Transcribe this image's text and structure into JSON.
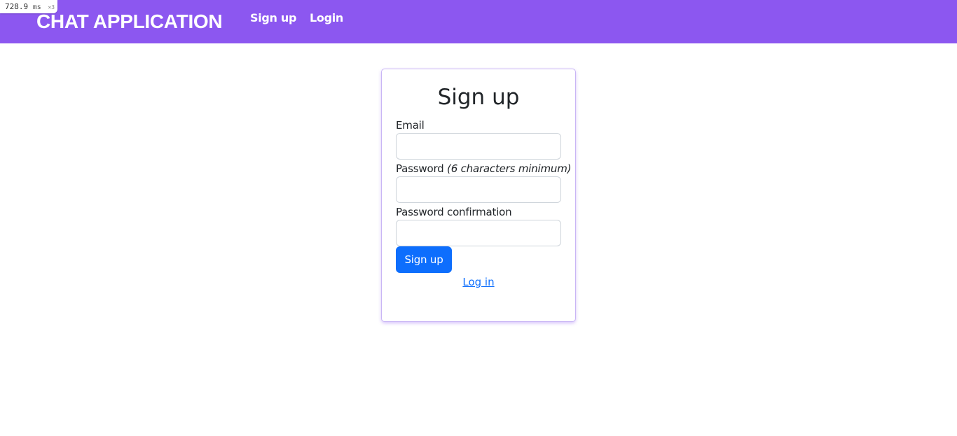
{
  "debug": {
    "time_value": "728.9",
    "time_unit": "ms",
    "multiplier": "×3"
  },
  "navbar": {
    "brand": "CHAT APPLICATION",
    "links": [
      {
        "label": "Sign up"
      },
      {
        "label": "Login"
      }
    ],
    "background": "#8c57f0"
  },
  "form": {
    "title": "Sign up",
    "email": {
      "label": "Email",
      "value": "",
      "placeholder": ""
    },
    "password": {
      "label": "Password",
      "hint": "(6 characters minimum)",
      "value": "",
      "placeholder": ""
    },
    "password_confirmation": {
      "label": "Password confirmation",
      "value": "",
      "placeholder": ""
    },
    "submit_label": "Sign up",
    "login_link": "Log in",
    "accent": "#0d6efd"
  }
}
